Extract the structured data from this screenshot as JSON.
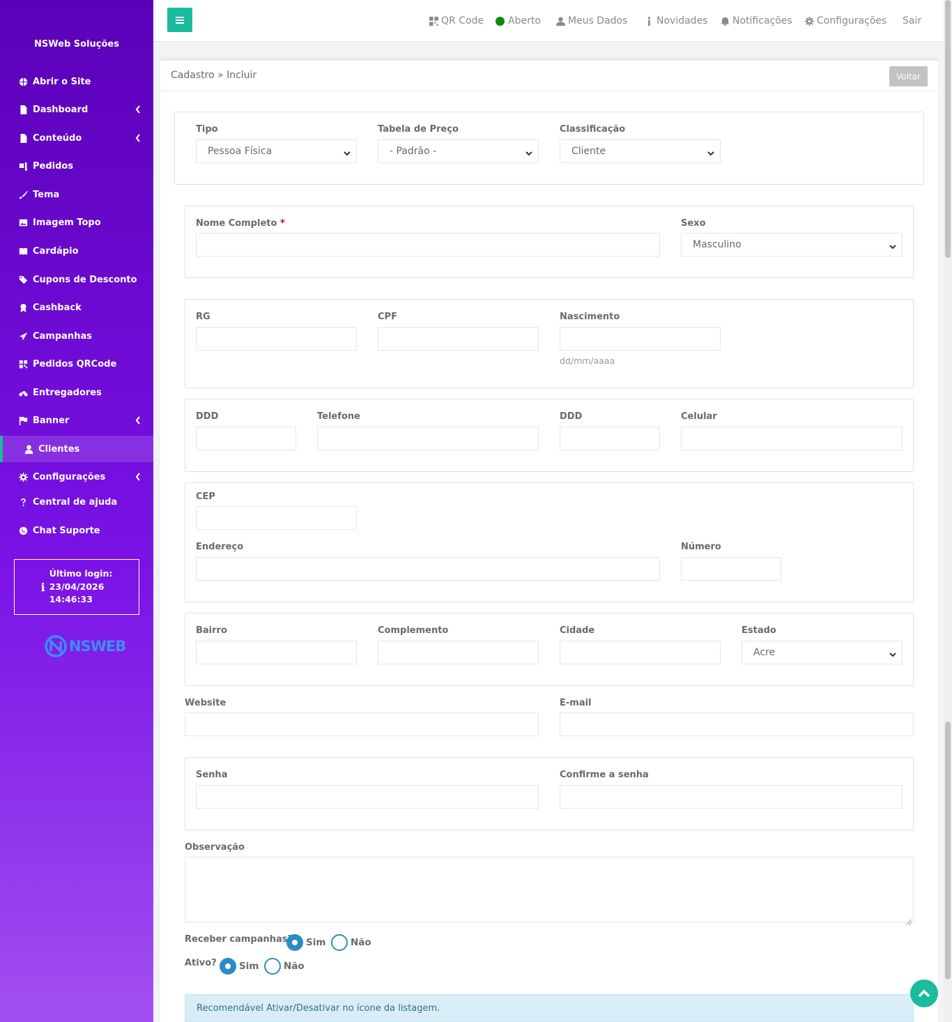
{
  "sidebar": {
    "brand": "NSWeb Soluções",
    "items": [
      {
        "label": "Abrir o Site",
        "icon": "globe-icon",
        "chevron": false
      },
      {
        "label": "Dashboard",
        "icon": "file-icon",
        "chevron": true
      },
      {
        "label": "Conteúdo",
        "icon": "file-icon",
        "chevron": true
      },
      {
        "label": "Pedidos",
        "icon": "dolly-icon",
        "chevron": false
      },
      {
        "label": "Tema",
        "icon": "brush-icon",
        "chevron": false
      },
      {
        "label": "Imagem Topo",
        "icon": "image-icon",
        "chevron": false
      },
      {
        "label": "Cardápio",
        "icon": "book-icon",
        "chevron": false
      },
      {
        "label": "Cupons de Desconto",
        "icon": "tags-icon",
        "chevron": false
      },
      {
        "label": "Cashback",
        "icon": "award-icon",
        "chevron": false
      },
      {
        "label": "Campanhas",
        "icon": "paper-plane-icon",
        "chevron": false
      },
      {
        "label": "Pedidos QRCode",
        "icon": "qrcode-icon",
        "chevron": false
      },
      {
        "label": "Entregadores",
        "icon": "motorcycle-icon",
        "chevron": false
      },
      {
        "label": "Banner",
        "icon": "flag-icon",
        "chevron": true
      },
      {
        "label": "Clientes",
        "icon": "user-icon",
        "chevron": false,
        "active": true
      },
      {
        "label": "Configurações",
        "icon": "gear-icon",
        "chevron": true
      },
      {
        "label": "Central de ajuda",
        "icon": "question-icon",
        "chevron": false
      },
      {
        "label": "Chat Suporte",
        "icon": "whatsapp-icon",
        "chevron": false
      }
    ],
    "last_login": {
      "label": "Último login:",
      "date": "23/04/2026",
      "time": "14:46:33"
    },
    "logo_text": "NSWEB"
  },
  "topbar": {
    "qr": "QR Code",
    "status": "Aberto",
    "meus_dados": "Meus Dados",
    "novidades": "Novidades",
    "notificacoes": "Notificações",
    "configuracoes": "Configurações",
    "sair": "Sair",
    "status_color": "#0c8a0c"
  },
  "page": {
    "breadcrumb": "Cadastro » Incluir",
    "voltar": "Voltar"
  },
  "form": {
    "tipo": {
      "label": "Tipo",
      "value": "Pessoa Física"
    },
    "tabela": {
      "label": "Tabela de Preço",
      "value": "- Padrão -"
    },
    "classificacao": {
      "label": "Classificação",
      "value": "Cliente"
    },
    "nome": {
      "label": "Nome Completo",
      "required": "*"
    },
    "sexo": {
      "label": "Sexo",
      "value": "Masculino"
    },
    "rg": {
      "label": "RG"
    },
    "cpf": {
      "label": "CPF"
    },
    "nascimento": {
      "label": "Nascimento",
      "hint": "dd/mm/aaaa"
    },
    "ddd1": {
      "label": "DDD"
    },
    "telefone": {
      "label": "Telefone"
    },
    "ddd2": {
      "label": "DDD"
    },
    "celular": {
      "label": "Celular"
    },
    "cep": {
      "label": "CEP"
    },
    "endereco": {
      "label": "Endereço"
    },
    "numero": {
      "label": "Número"
    },
    "bairro": {
      "label": "Bairro"
    },
    "complemento": {
      "label": "Complemento"
    },
    "cidade": {
      "label": "Cidade"
    },
    "estado": {
      "label": "Estado",
      "value": "Acre"
    },
    "website": {
      "label": "Website"
    },
    "email": {
      "label": "E-mail"
    },
    "senha": {
      "label": "Senha"
    },
    "confirme": {
      "label": "Confirme a senha"
    },
    "observacao": {
      "label": "Observação"
    },
    "campanhas": {
      "label": "Receber campanhas?",
      "sim": "Sim",
      "nao": "Não",
      "selected": "Sim"
    },
    "ativo": {
      "label": "Ativo?",
      "sim": "Sim",
      "nao": "Não",
      "selected": "Sim"
    },
    "alert": "Recomendável Ativar/Desativar no ícone da listagem."
  }
}
